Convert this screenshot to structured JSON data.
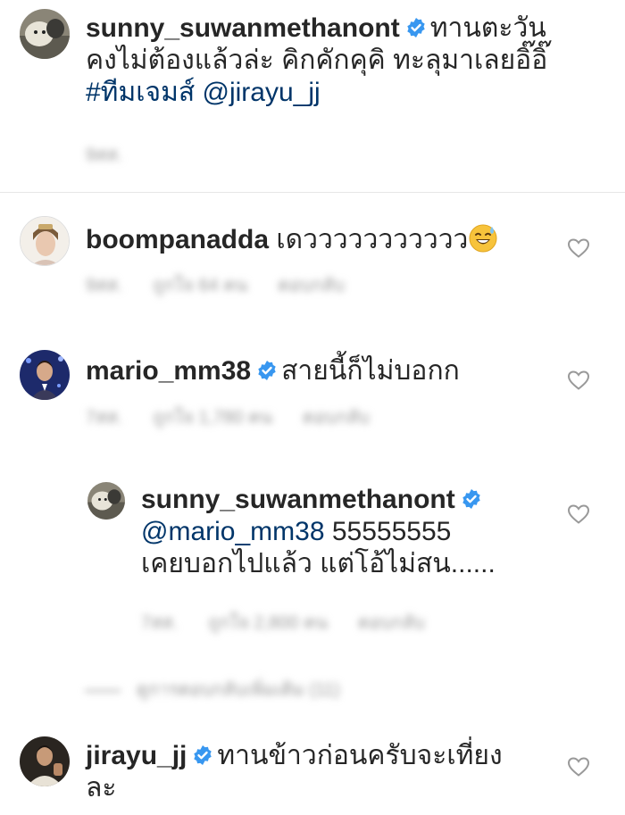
{
  "caption": {
    "username": "sunny_suwanmethanont",
    "text_line1": "ทานตะวัน",
    "text_line2": "คงไม่ต้องแล้วล่ะ คิกคักคุคิ ทะลุมาเลยอิ๊อิ๊",
    "hashtag": "#ทีมเจมส์",
    "mention": "@jirayu_jj",
    "time": "9สส."
  },
  "comments": [
    {
      "username": "boompanadda",
      "text": "เดววววววววววว",
      "emoji": "sweat-smile-emoji",
      "time": "9สส.",
      "likes": "ถูกใจ 64 คน",
      "reply": "ตอบกลับ"
    },
    {
      "username": "mario_mm38",
      "text": "สายนี้ก็ไม่บอกก",
      "time": "7สส.",
      "likes": "ถูกใจ 1,780 คน",
      "reply": "ตอบกลับ"
    },
    {
      "username": "sunny_suwanmethanont",
      "mention": "@mario_mm38",
      "text_line1": " 55555555",
      "text_line2": "เคยบอกไปแล้ว แต่โอ้ไม่สน......",
      "time": "7สส.",
      "likes": "ถูกใจ 2,800 คน",
      "reply": "ตอบกลับ",
      "view_replies": "ดูการตอบกลับเพิ่มเติม (11)"
    },
    {
      "username": "jirayu_jj",
      "text_line1": "ทานข้าวก่อนครับจะเที่ยง",
      "text_line2": "ละ"
    }
  ],
  "colors": {
    "text": "#262626",
    "link": "#003569",
    "verified": "#3897f0",
    "meta": "#999999",
    "divider": "#e6e6e6"
  },
  "icons": {
    "verified": "verified-badge-icon",
    "like": "heart-outline-icon"
  }
}
